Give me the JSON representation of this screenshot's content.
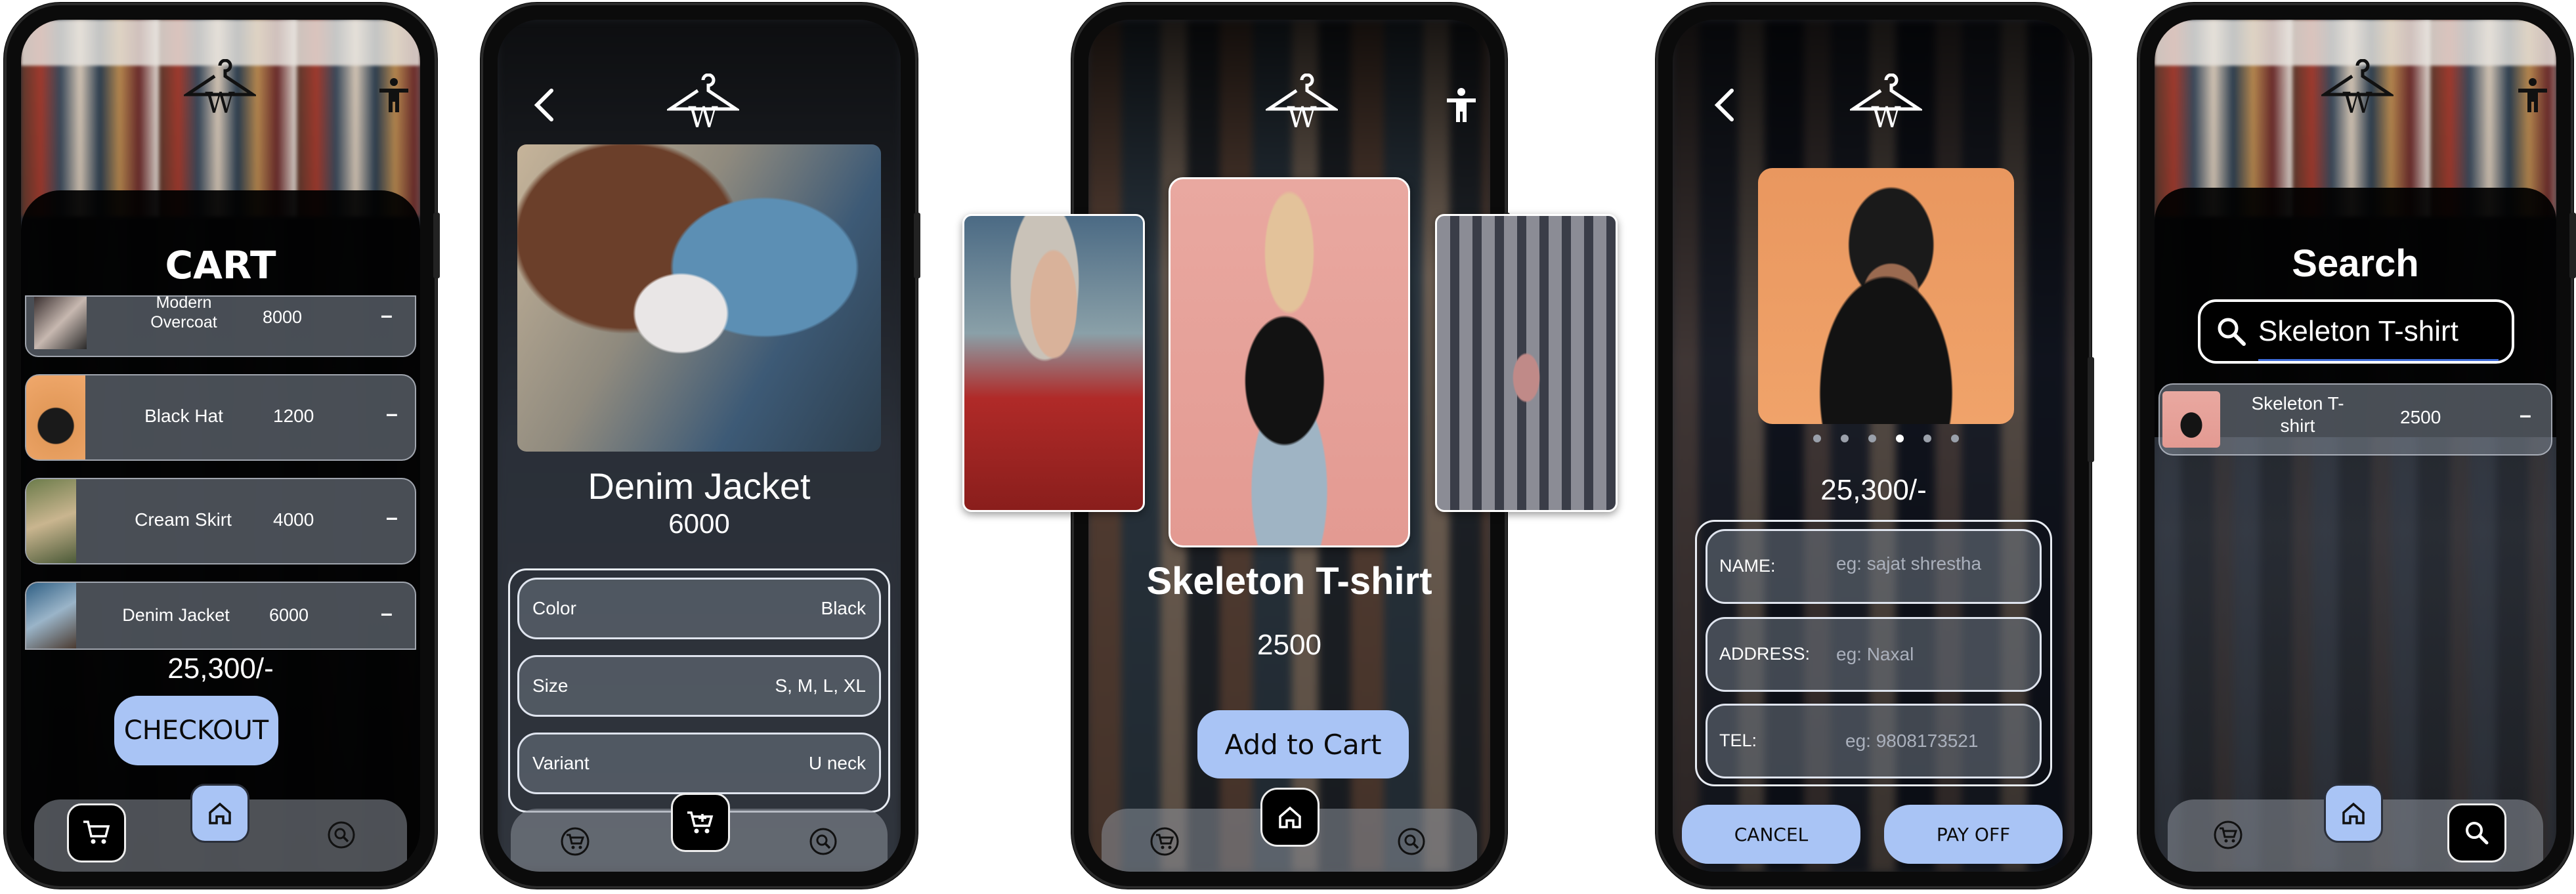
{
  "screen1": {
    "title": "CART",
    "items": [
      {
        "name": "Modern\nOvercoat",
        "price": "8000",
        "remove": "–"
      },
      {
        "name": "Black Hat",
        "price": "1200",
        "remove": "–"
      },
      {
        "name": "Cream Skirt",
        "price": "4000",
        "remove": "–"
      },
      {
        "name": "Denim Jacket",
        "price": "6000",
        "remove": "–"
      }
    ],
    "total": "25,300/-",
    "checkout": "CHECKOUT"
  },
  "screen2": {
    "product_name": "Denim Jacket",
    "price": "6000",
    "attributes": [
      {
        "label": "Color",
        "value": "Black"
      },
      {
        "label": "Size",
        "value": "S, M, L, XL"
      },
      {
        "label": "Variant",
        "value": "U neck"
      }
    ]
  },
  "screen3": {
    "product_name": "Skeleton T-shirt",
    "price": "2500",
    "add_to_cart": "Add to Cart"
  },
  "screen4": {
    "total": "25,300/-",
    "carousel_dots": 6,
    "active_dot": 4,
    "fields": [
      {
        "label": "NAME:",
        "placeholder": "eg: sajat shrestha"
      },
      {
        "label": "ADDRESS:",
        "placeholder": "eg: Naxal"
      },
      {
        "label": "TEL:",
        "placeholder": "eg: 9808173521"
      }
    ],
    "cancel": "CANCEL",
    "pay_off": "PAY OFF"
  },
  "screen5": {
    "title": "Search",
    "search_value": "Skeleton T-shirt",
    "result": {
      "name": "Skeleton T-\nshirt",
      "price": "2500",
      "remove": "–"
    }
  },
  "colors": {
    "accent": "#a9c4f5",
    "dark": "#000000",
    "card": "#7a8290"
  },
  "icons": [
    "hanger-logo-icon",
    "accessibility-icon",
    "back-chevron-icon",
    "cart-icon",
    "home-icon",
    "search-icon"
  ]
}
